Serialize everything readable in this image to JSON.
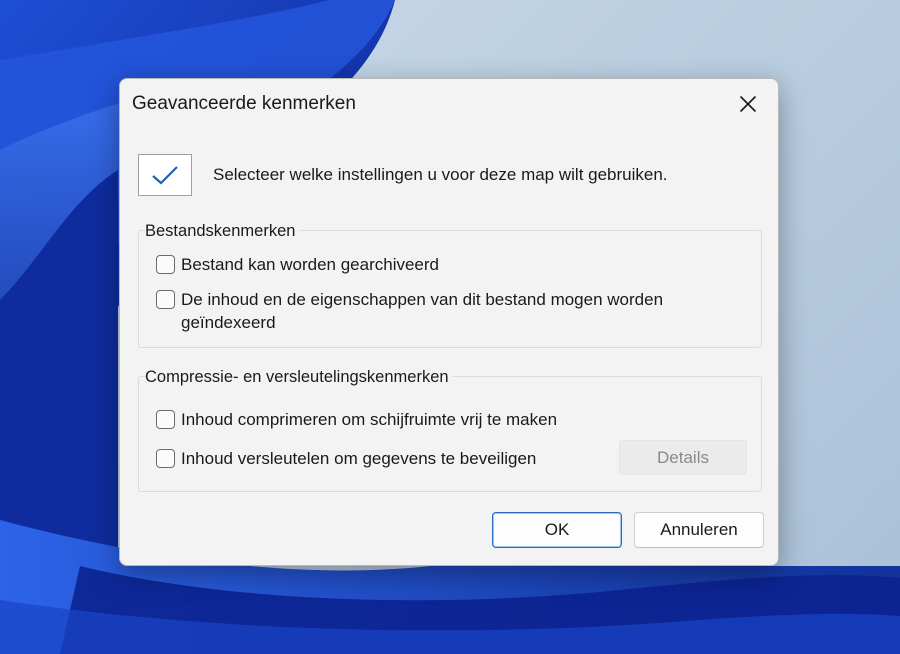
{
  "dialog": {
    "title": "Geavanceerde kenmerken",
    "close_icon": "close-icon",
    "intro_text": "Selecteer welke instellingen u voor deze map wilt gebruiken.",
    "folder_apply_checked": true
  },
  "groups": {
    "file_attributes": {
      "legend": "Bestandskenmerken",
      "options": [
        {
          "label": "Bestand kan worden gearchiveerd",
          "checked": false
        },
        {
          "label": "De inhoud en de eigenschappen van dit bestand mogen worden geïndexeerd",
          "checked": false
        }
      ]
    },
    "compress_encrypt": {
      "legend": "Compressie- en versleutelingskenmerken",
      "options": [
        {
          "label": "Inhoud comprimeren om schijfruimte vrij te maken",
          "checked": false
        },
        {
          "label": "Inhoud versleutelen om gegevens te beveiligen",
          "checked": false
        }
      ],
      "details_label": "Details",
      "details_enabled": false
    }
  },
  "buttons": {
    "ok_label": "OK",
    "cancel_label": "Annuleren"
  },
  "colors": {
    "accent": "#2a6cc4",
    "checkmark": "#1f5fb8",
    "dialog_bg": "#f3f3f3"
  }
}
